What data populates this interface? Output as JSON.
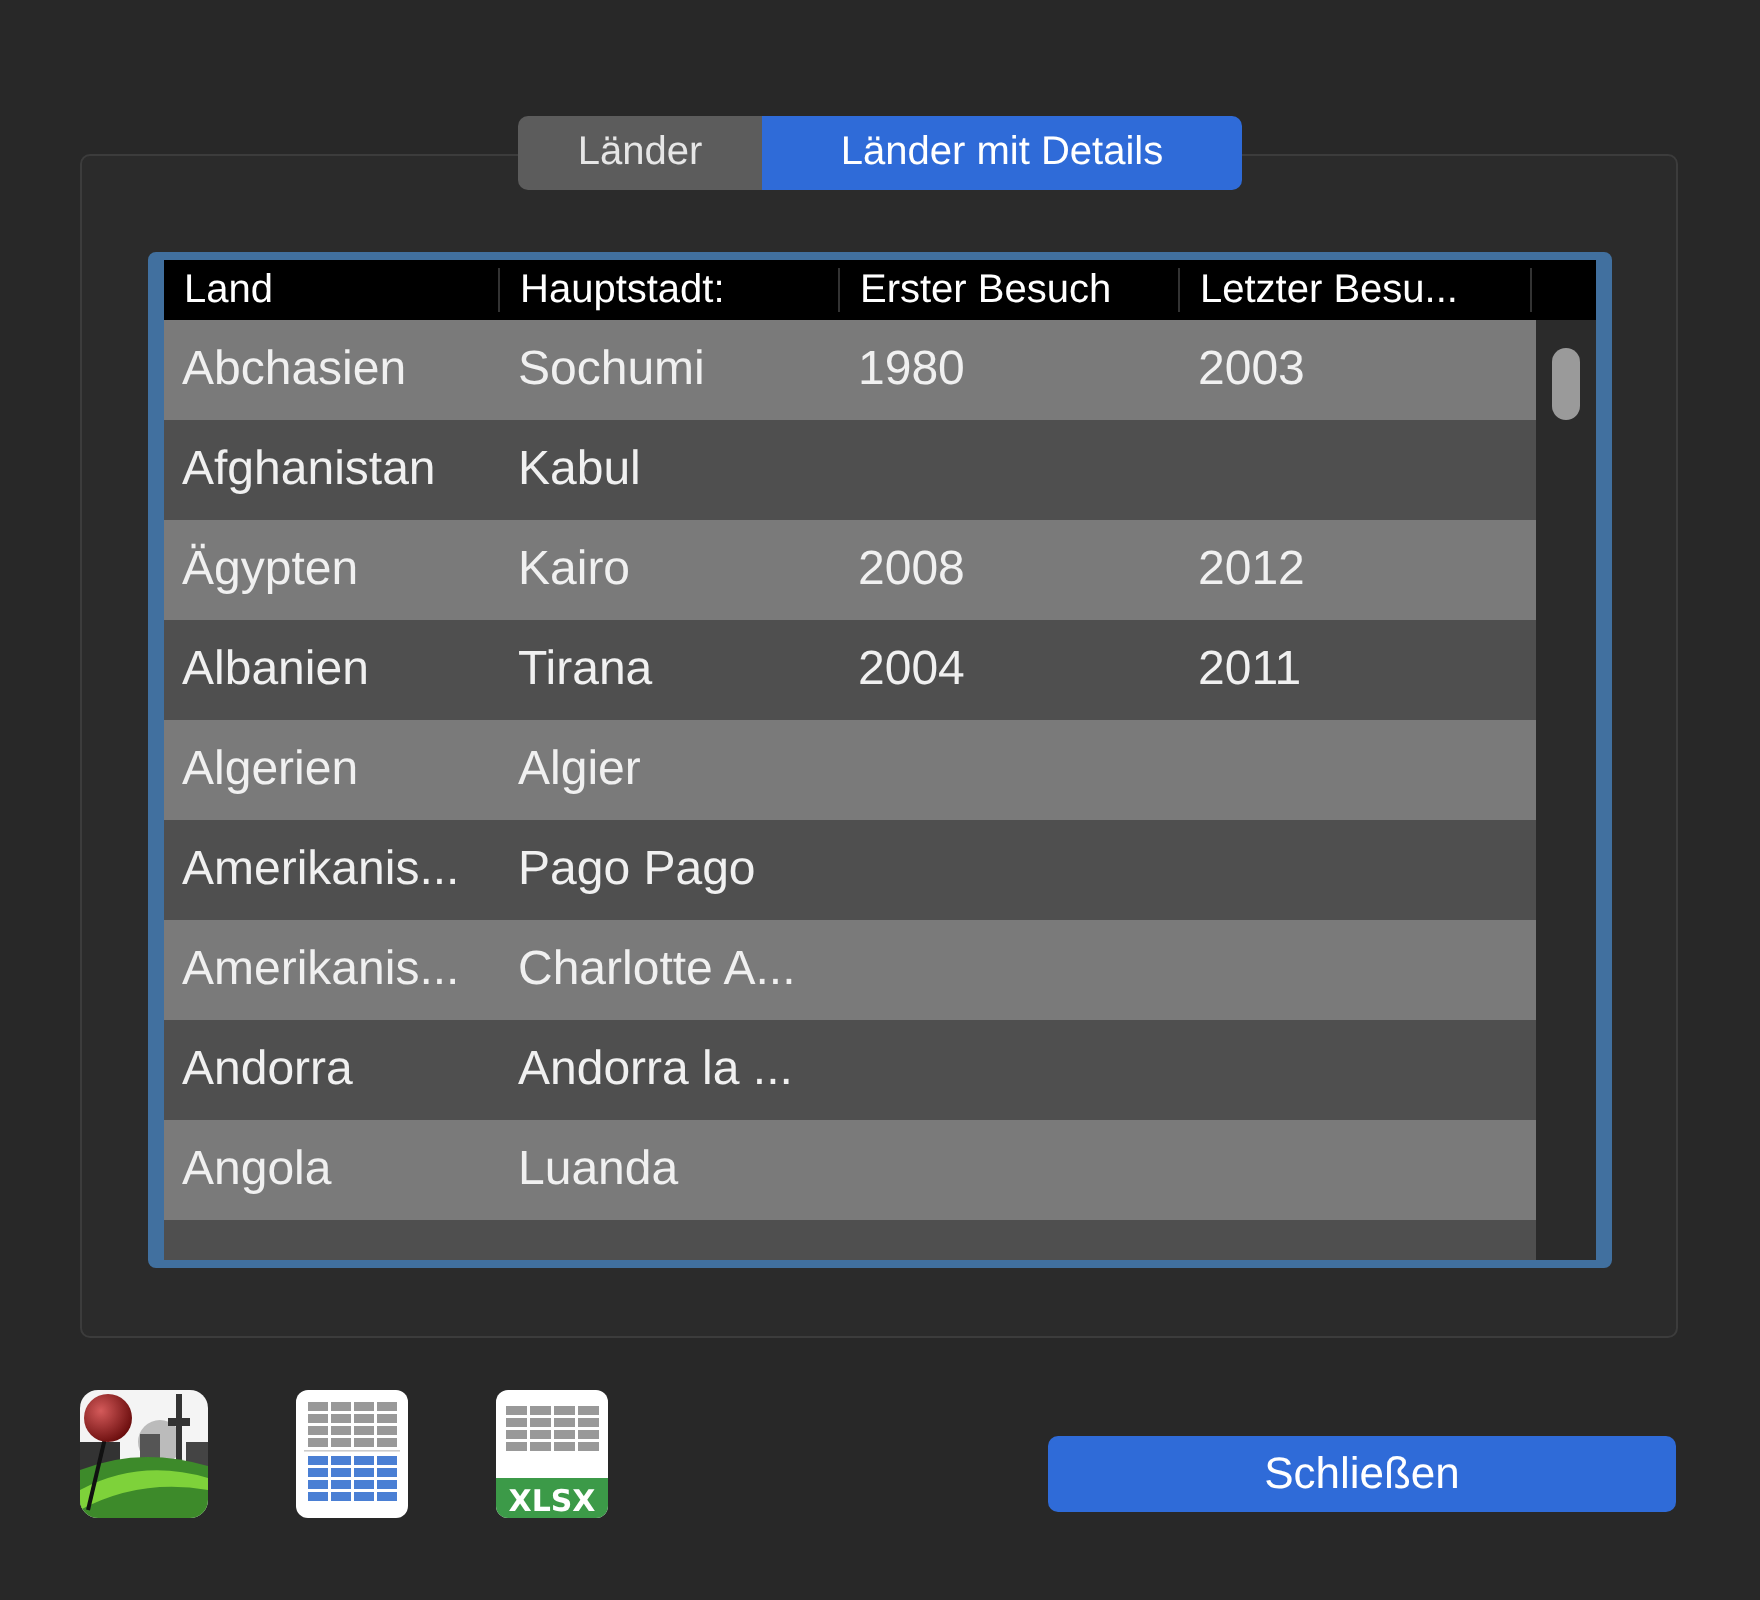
{
  "tabs": [
    {
      "label": "Länder",
      "selected": false
    },
    {
      "label": "Länder mit Details",
      "selected": true
    }
  ],
  "table": {
    "columns": [
      "Land",
      "Hauptstadt:",
      "Erster Besuch",
      "Letzter Besu..."
    ],
    "rows": [
      {
        "cells": [
          "Abchasien",
          "Sochumi",
          "1980",
          "2003"
        ]
      },
      {
        "cells": [
          "Afghanistan",
          "Kabul"
        ]
      },
      {
        "cells": [
          "Ägypten",
          "Kairo",
          "2008",
          "2012"
        ]
      },
      {
        "cells": [
          "Albanien",
          "Tirana",
          "2004",
          "2011"
        ]
      },
      {
        "cells": [
          "Algerien",
          "Algier"
        ]
      },
      {
        "cells": [
          "Amerikanis...",
          "Pago Pago"
        ]
      },
      {
        "cells": [
          "Amerikanis...",
          "Charlotte A..."
        ]
      },
      {
        "cells": [
          "Andorra",
          "Andorra la ..."
        ]
      },
      {
        "cells": [
          "Angola",
          "Luanda"
        ]
      }
    ]
  },
  "xlsx_icon_label": "XLSX",
  "close_button": "Schließen"
}
